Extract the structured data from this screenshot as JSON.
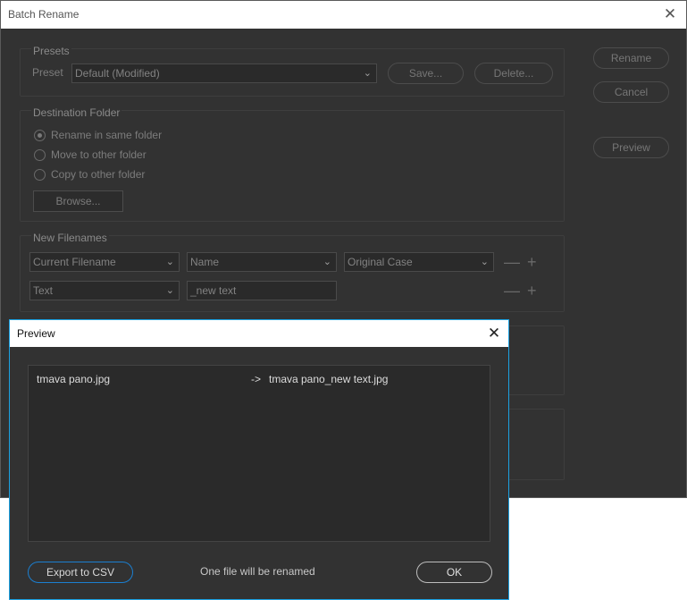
{
  "main_window": {
    "title": "Batch Rename",
    "close_glyph": "✕",
    "buttons": {
      "rename": "Rename",
      "cancel": "Cancel",
      "preview": "Preview"
    },
    "presets": {
      "group_title": "Presets",
      "preset_label": "Preset",
      "preset_value": "Default (Modified)",
      "save_label": "Save...",
      "delete_label": "Delete..."
    },
    "destination": {
      "group_title": "Destination Folder",
      "options": [
        {
          "label": "Rename in same folder",
          "selected": true
        },
        {
          "label": "Move to other folder",
          "selected": false
        },
        {
          "label": "Copy to other folder",
          "selected": false
        }
      ],
      "browse_label": "Browse..."
    },
    "new_filenames": {
      "group_title": "New Filenames",
      "rows": [
        {
          "type": "Current Filename",
          "field2": "Name",
          "field3": "Original Case"
        },
        {
          "type": "Text",
          "text_value": "_new text"
        }
      ],
      "minus_glyph": "—",
      "plus_glyph": "+"
    }
  },
  "preview_dialog": {
    "title": "Preview",
    "close_glyph": "✕",
    "rows": [
      {
        "original": "tmava pano.jpg",
        "arrow": "->",
        "renamed": "tmava pano_new text.jpg"
      }
    ],
    "export_label": "Export to CSV",
    "status": "One file will be renamed",
    "ok_label": "OK"
  },
  "colors": {
    "dialog_bg": "#323232",
    "preview_border": "#1ba1e2",
    "export_border": "#1b7fd0"
  }
}
